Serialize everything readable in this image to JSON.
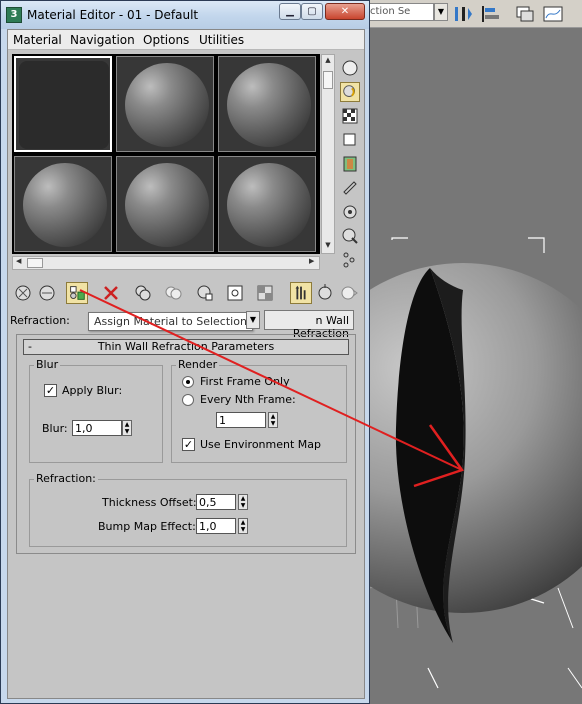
{
  "main_toolbar": {
    "selection_set_value": "ction Se"
  },
  "window": {
    "title": "Material Editor - 01 - Default",
    "icon_text": "3"
  },
  "menu": {
    "items": [
      "Material",
      "Navigation",
      "Options",
      "Utilities"
    ]
  },
  "refraction": {
    "label": "Refraction:",
    "tooltip": "Assign Material to Selection",
    "type_button": "n Wall Refraction"
  },
  "rollout": {
    "title": "Thin Wall Refraction Parameters",
    "collapse_symbol": "-",
    "blur_group": {
      "title": "Blur",
      "apply_blur_label": "Apply Blur:",
      "apply_blur_checked": true,
      "blur_label": "Blur:",
      "blur_value": "1,0"
    },
    "render_group": {
      "title": "Render",
      "first_frame_label": "First Frame Only",
      "every_nth_label": "Every Nth Frame:",
      "selected": "first_frame",
      "nth_value": "1",
      "use_env_label": "Use Environment Map",
      "use_env_checked": true
    },
    "refraction_group": {
      "title": "Refraction:",
      "thickness_label": "Thickness Offset:",
      "thickness_value": "0,5",
      "bump_label": "Bump Map Effect:",
      "bump_value": "1,0"
    }
  },
  "colors": {
    "annotation_arrow": "#e02020",
    "viewport_bg": "#777777"
  }
}
